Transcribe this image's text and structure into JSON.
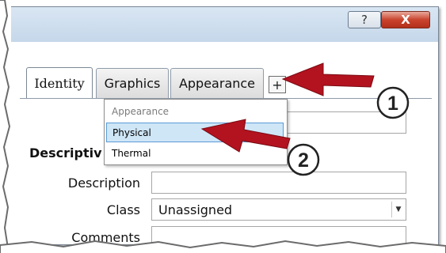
{
  "window": {
    "help_glyph": "?",
    "close_glyph": "X"
  },
  "tabs": [
    {
      "label": "Identity",
      "active": true
    },
    {
      "label": "Graphics",
      "active": false
    },
    {
      "label": "Appearance",
      "active": false
    }
  ],
  "add_tab_button": {
    "label": "+"
  },
  "dropdown": {
    "header": "Appearance",
    "items": [
      {
        "label": "Physical",
        "highlighted": true
      },
      {
        "label": "Thermal",
        "highlighted": false
      }
    ]
  },
  "properties": {
    "section_label": "Descriptiv",
    "description_label": "Description",
    "description_value": "",
    "class_label": "Class",
    "class_value": "Unassigned",
    "comments_label": "Comments",
    "comments_value": ""
  },
  "callouts": [
    {
      "number": "1",
      "target": "add tab button"
    },
    {
      "number": "2",
      "target": "Physical menu item"
    }
  ],
  "colors": {
    "arrow": "#b3121f",
    "highlight": "#cfe6f7",
    "close_button": "#c9432d"
  }
}
